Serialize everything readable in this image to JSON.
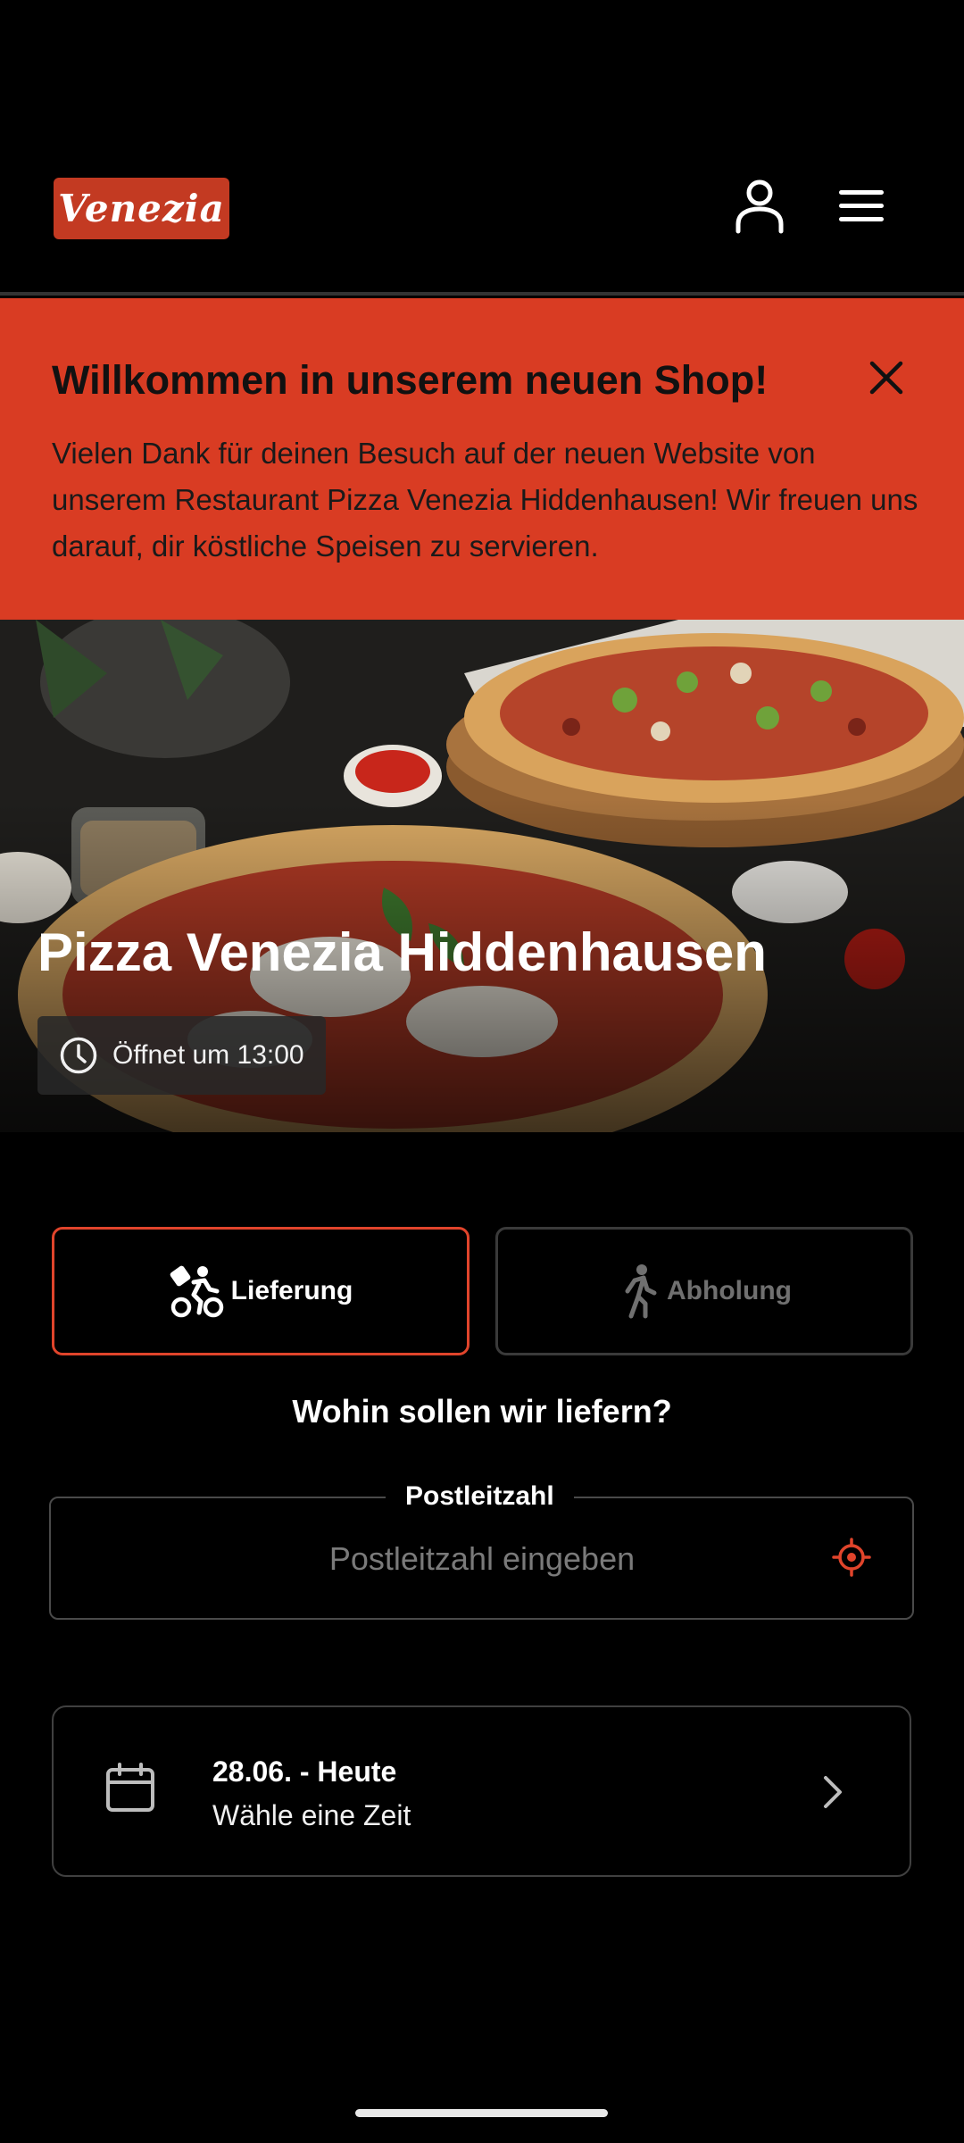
{
  "header": {
    "logo_text": "Venezia",
    "user_icon": "user-icon",
    "menu_icon": "hamburger-menu-icon"
  },
  "banner": {
    "title": "Willkommen in unserem neuen Shop!",
    "text": "Vielen Dank für deinen Besuch auf der neuen Website von unserem Restaurant Pizza Venezia Hiddenhausen! Wir freuen uns darauf, dir köstliche Speisen zu servieren.",
    "close_icon": "close-icon",
    "color": "#d93c23"
  },
  "hero": {
    "title": "Pizza Venezia Hiddenhausen",
    "opening_text": "Öffnet um 13:00",
    "clock_icon": "clock-icon"
  },
  "order_mode": {
    "delivery_label": "Lieferung",
    "delivery_icon": "bicycle-delivery-icon",
    "pickup_label": "Abholung",
    "pickup_icon": "walking-icon",
    "selected": "Lieferung",
    "accent": "#e0442b"
  },
  "delivery": {
    "question": "Wohin sollen wir liefern?",
    "postal_label": "Postleitzahl",
    "postal_placeholder": "Postleitzahl eingeben",
    "postal_value": "",
    "locate_icon": "crosshair-location-icon"
  },
  "schedule": {
    "date_text": "28.06. - Heute",
    "time_prompt": "Wähle eine Zeit",
    "calendar_icon": "calendar-icon",
    "chevron_icon": "chevron-right-icon"
  }
}
